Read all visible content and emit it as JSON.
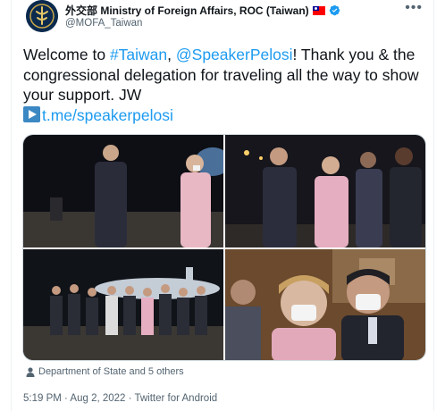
{
  "account": {
    "name": "外交部 Ministry of Foreign Affairs, ROC (Taiwan)",
    "handle": "@MOFA_Taiwan",
    "more_label": "•••"
  },
  "tweet": {
    "text_1": "Welcome to ",
    "hashtag": "#Taiwan",
    "text_2": ", ",
    "mention": "@SpeakerPelosi",
    "text_3": "! Thank you & the congressional delegation for traveling all the way to show your support. JW",
    "link": "t.me/speakerpelosi"
  },
  "tags": {
    "label": "Department of State and 5 others"
  },
  "meta": {
    "time": "5:19 PM",
    "sep1": " · ",
    "date": "Aug 2, 2022",
    "sep2": " · ",
    "source": "Twitter for Android"
  },
  "colors": {
    "link": "#1d9bf0",
    "secondary_text": "#536471",
    "verified": "#1d9bf0"
  }
}
